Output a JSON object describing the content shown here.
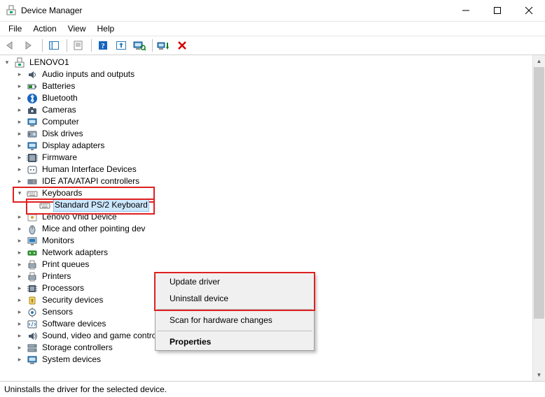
{
  "title": "Device Manager",
  "menu": [
    "File",
    "Action",
    "View",
    "Help"
  ],
  "root_node": "LENOVO1",
  "categories": [
    "Audio inputs and outputs",
    "Batteries",
    "Bluetooth",
    "Cameras",
    "Computer",
    "Disk drives",
    "Display adapters",
    "Firmware",
    "Human Interface Devices",
    "IDE ATA/ATAPI controllers",
    "Keyboards",
    "Lenovo Vhid Device",
    "Mice and other pointing dev",
    "Monitors",
    "Network adapters",
    "Print queues",
    "Printers",
    "Processors",
    "Security devices",
    "Sensors",
    "Software devices",
    "Sound, video and game controllers",
    "Storage controllers",
    "System devices"
  ],
  "expanded_category_index": 10,
  "selected_device": "Standard PS/2 Keyboard",
  "context_menu": {
    "update": "Update driver",
    "uninstall": "Uninstall device",
    "scan": "Scan for hardware changes",
    "properties": "Properties"
  },
  "status": "Uninstalls the driver for the selected device."
}
